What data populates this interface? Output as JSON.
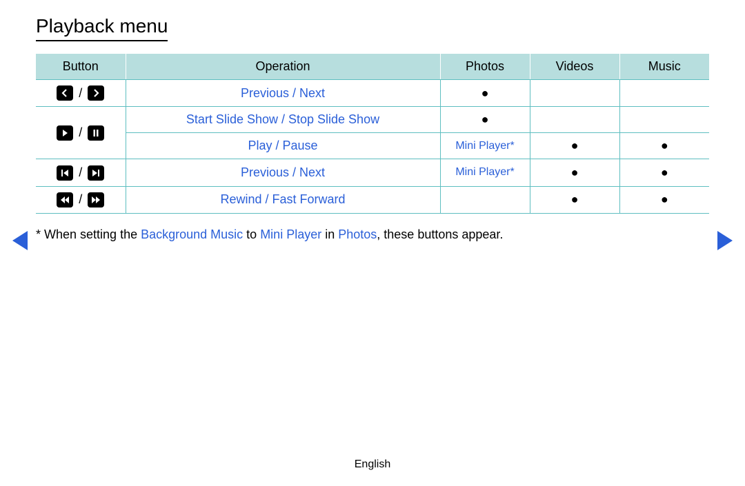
{
  "title": "Playback menu",
  "headers": {
    "button": "Button",
    "operation": "Operation",
    "photos": "Photos",
    "videos": "Videos",
    "music": "Music"
  },
  "dot": "●",
  "mini": "Mini Player*",
  "ops": {
    "prevnext": "Previous / Next",
    "slideshow": "Start Slide Show / Stop Slide Show",
    "playpause": "Play / Pause",
    "prevnext2": "Previous / Next",
    "rwff": "Rewind / Fast Forward"
  },
  "footnote": {
    "p1": "* When setting the ",
    "bg": "Background Music",
    "p2": " to ",
    "mp": "Mini Player",
    "p3": " in ",
    "ph": "Photos",
    "p4": ", these buttons appear."
  },
  "footer": "English"
}
